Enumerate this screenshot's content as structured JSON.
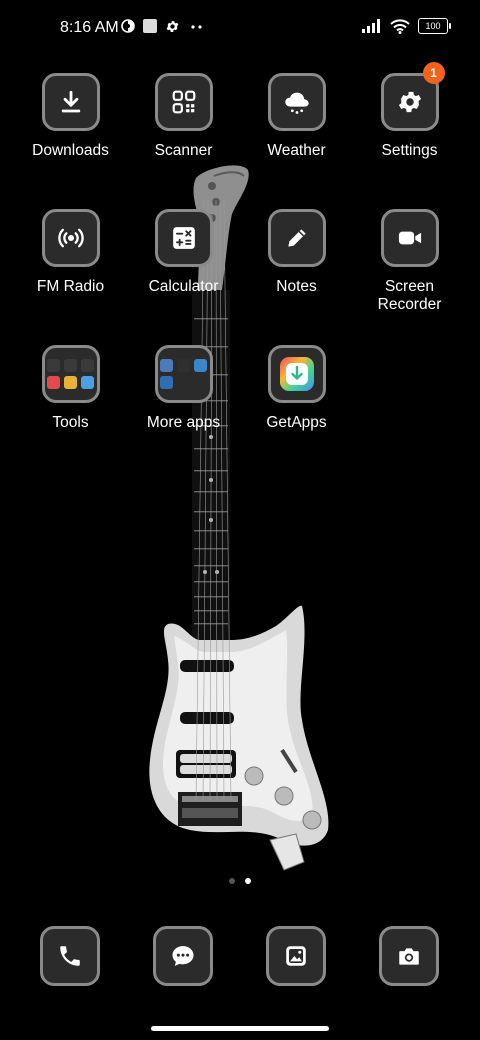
{
  "status_bar": {
    "time": "8:16 AM",
    "battery_level": "100",
    "icons": [
      "data-saver-icon",
      "notification-square-icon",
      "gear-icon",
      "more-dots-icon",
      "signal-icon",
      "wifi-icon",
      "battery-icon"
    ]
  },
  "apps": [
    {
      "label": "Downloads",
      "icon": "download-icon"
    },
    {
      "label": "Scanner",
      "icon": "qr-scan-icon"
    },
    {
      "label": "Weather",
      "icon": "cloud-rain-icon"
    },
    {
      "label": "Settings",
      "icon": "gear-icon",
      "badge": "1"
    },
    {
      "label": "FM Radio",
      "icon": "radio-icon"
    },
    {
      "label": "Calculator",
      "icon": "calculator-icon"
    },
    {
      "label": "Notes",
      "icon": "pencil-icon"
    },
    {
      "label": "Screen Recorder",
      "label_line1": "Screen",
      "label_line2": "Recorder",
      "icon": "video-camera-icon"
    },
    {
      "label": "Tools",
      "icon": "folder-icon"
    },
    {
      "label": "More apps",
      "icon": "folder-icon"
    },
    {
      "label": "GetApps",
      "icon": "getapps-icon"
    }
  ],
  "page_indicator": {
    "pages": 2,
    "current": 2
  },
  "dock": [
    {
      "icon": "phone-icon"
    },
    {
      "icon": "message-icon"
    },
    {
      "icon": "gallery-icon"
    },
    {
      "icon": "camera-icon"
    }
  ],
  "colors": {
    "badge": "#f2621c",
    "icon_bg": "#2b2b2b",
    "icon_border": "#8a8a8a",
    "background": "#000000"
  }
}
